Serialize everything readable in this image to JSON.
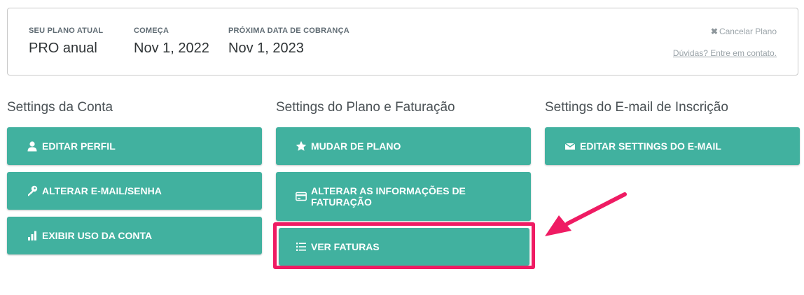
{
  "plan": {
    "current_plan_label": "SEU PLANO ATUAL",
    "current_plan_value": "PRO anual",
    "starts_label": "COMEÇA",
    "starts_value": "Nov 1, 2022",
    "next_billing_label": "PRÓXIMA DATA DE COBRANÇA",
    "next_billing_value": "Nov 1, 2023",
    "cancel_icon": "✖",
    "cancel_label": "Cancelar Plano",
    "contact_label": "Dúvidas? Entre em contato."
  },
  "sections": {
    "account": {
      "title": "Settings da Conta",
      "buttons": [
        {
          "label": "EDITAR PERFIL",
          "icon": "user-icon"
        },
        {
          "label": "ALTERAR E-MAIL/SENHA",
          "icon": "key-icon"
        },
        {
          "label": "EXIBIR USO DA CONTA",
          "icon": "bar-chart-icon"
        }
      ]
    },
    "billing": {
      "title": "Settings do Plano e Faturação",
      "buttons": [
        {
          "label": "MUDAR DE PLANO",
          "icon": "star-icon"
        },
        {
          "label": "ALTERAR AS INFORMAÇÕES DE FATURAÇÃO",
          "icon": "credit-card-icon"
        },
        {
          "label": "VER FATURAS",
          "icon": "list-icon"
        }
      ]
    },
    "email": {
      "title": "Settings do E-mail de Inscrição",
      "buttons": [
        {
          "label": "EDITAR SETTINGS DO E-MAIL",
          "icon": "envelope-icon"
        }
      ]
    }
  },
  "colors": {
    "button": "#41b19f",
    "highlight": "#ef1b63",
    "arrow": "#ef1b63"
  }
}
